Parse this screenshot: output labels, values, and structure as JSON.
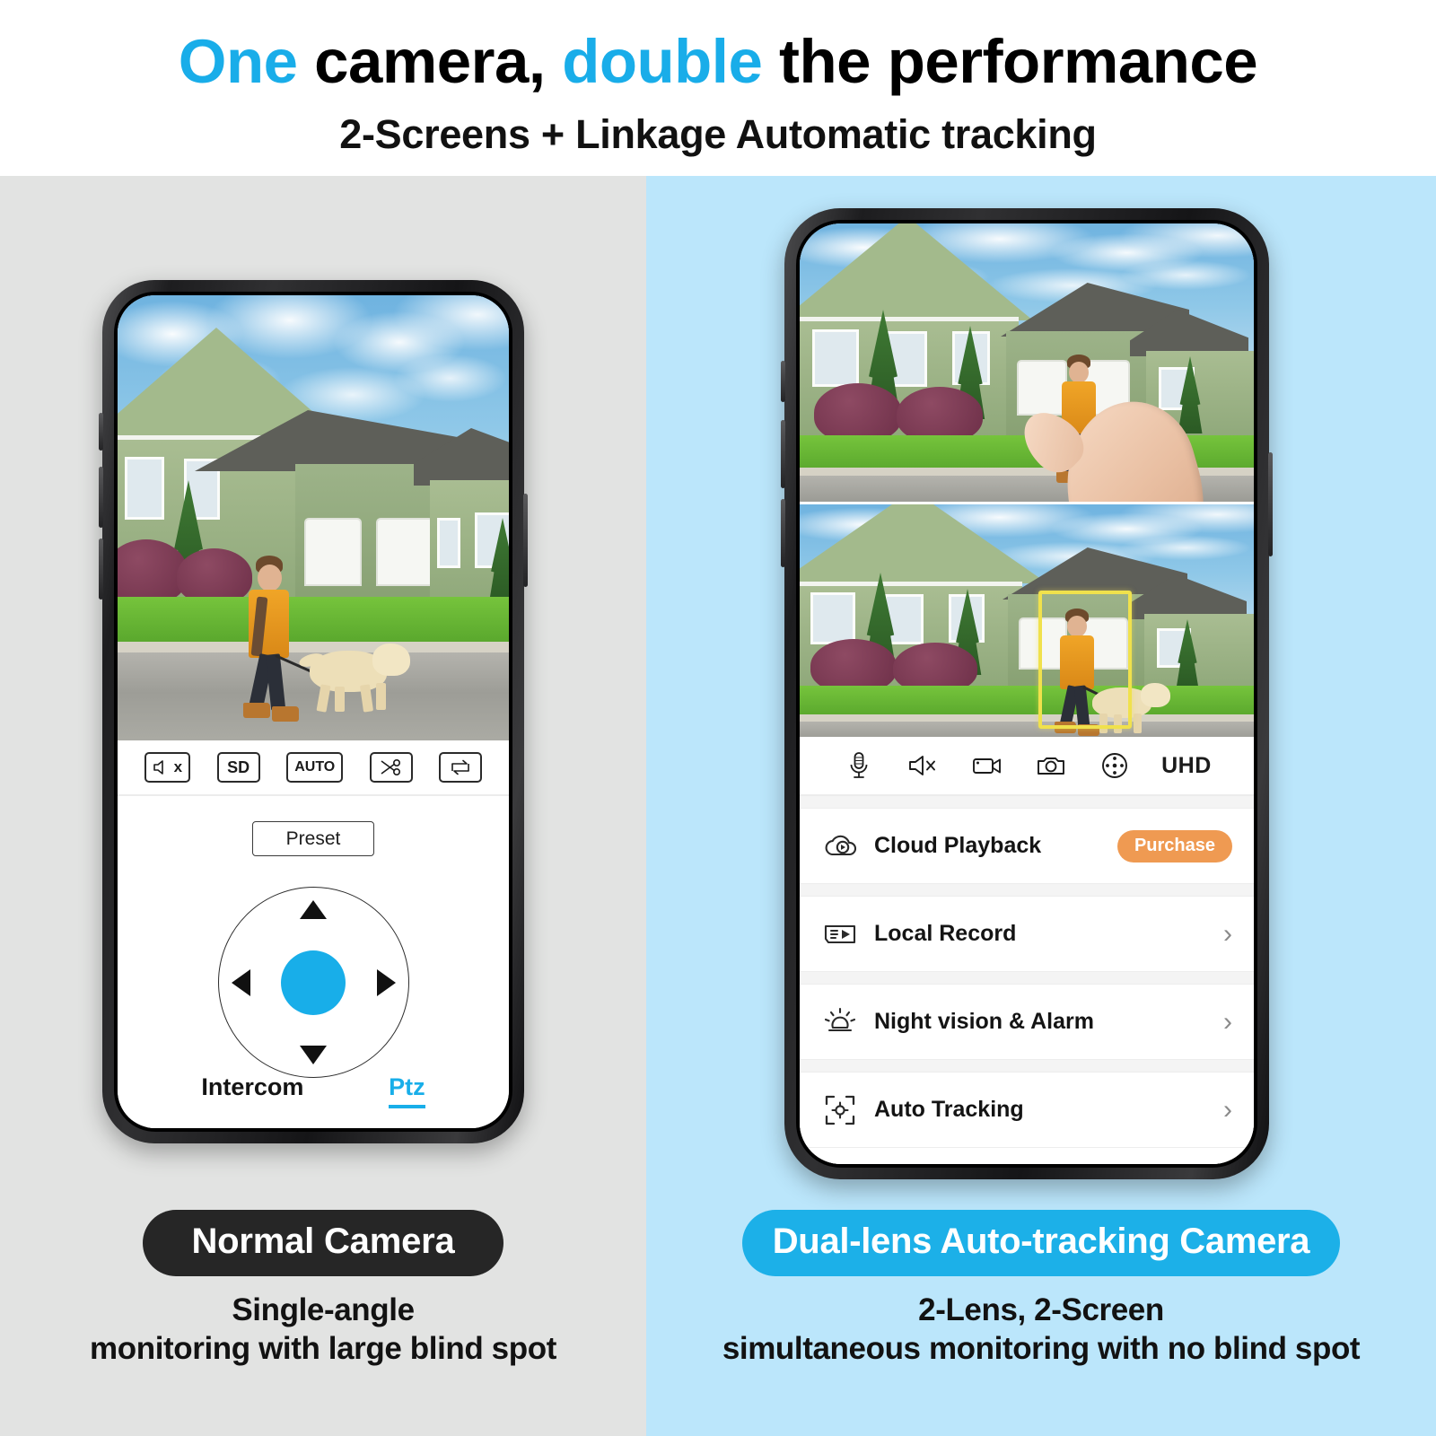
{
  "header": {
    "headline_part1": "One",
    "headline_part2": " camera, ",
    "headline_part3": "double",
    "headline_part4": " the performance",
    "subheadline": "2-Screens + Linkage Automatic tracking"
  },
  "colors": {
    "accent_blue": "#19ade9",
    "panel_left_bg": "#e2e3e2",
    "panel_right_bg": "#bbe6fb",
    "badge_dark": "#262626",
    "badge_blue": "#1cb0e8",
    "purchase_orange": "#ef9a52",
    "tracking_box_yellow": "#f0e14c"
  },
  "left_phone": {
    "toolbar": [
      {
        "name": "mute-speaker",
        "label": "x",
        "icon": "speaker-mute-icon"
      },
      {
        "name": "quality-sd",
        "label": "SD",
        "icon": "sd-quality-icon"
      },
      {
        "name": "quality-auto",
        "label": "AUTO",
        "icon": "auto-quality-icon"
      },
      {
        "name": "clip-cut",
        "label": "",
        "icon": "scissors-icon"
      },
      {
        "name": "loop-replay",
        "label": "",
        "icon": "loop-icon"
      }
    ],
    "preset_label": "Preset",
    "dpad": {
      "up": "up-arrow",
      "down": "down-arrow",
      "left": "left-arrow",
      "right": "right-arrow",
      "center": "ptz-center-button"
    },
    "tabs": [
      {
        "label": "Intercom",
        "active": false
      },
      {
        "label": "Ptz",
        "active": true
      }
    ]
  },
  "right_phone": {
    "toolbar": [
      {
        "name": "microphone",
        "icon": "microphone-icon",
        "label": ""
      },
      {
        "name": "mute-speaker",
        "icon": "speaker-mute-icon",
        "label": ""
      },
      {
        "name": "record-video",
        "icon": "video-camera-icon",
        "label": ""
      },
      {
        "name": "snapshot",
        "icon": "photo-camera-icon",
        "label": ""
      },
      {
        "name": "ptz-control",
        "icon": "ptz-dial-icon",
        "label": ""
      },
      {
        "name": "resolution",
        "icon": "",
        "label": "UHD"
      }
    ],
    "settings_rows": [
      {
        "label": "Cloud Playback",
        "icon": "cloud-playback-icon",
        "action": "Purchase",
        "action_type": "pill",
        "chevron": false
      },
      {
        "label": "Local Record",
        "icon": "local-record-icon",
        "action": "",
        "action_type": "chevron",
        "chevron": true
      },
      {
        "label": "Night vision & Alarm",
        "icon": "night-vision-alarm-icon",
        "action": "",
        "action_type": "chevron",
        "chevron": true
      },
      {
        "label": "Auto Tracking",
        "icon": "auto-tracking-icon",
        "action": "",
        "action_type": "chevron",
        "chevron": true
      }
    ]
  },
  "captions": {
    "left_badge": "Normal Camera",
    "left_line1": "Single-angle",
    "left_line2": "monitoring with large blind spot",
    "right_badge": "Dual-lens Auto-tracking Camera",
    "right_line1": "2-Lens, 2-Screen",
    "right_line2": "simultaneous monitoring with no blind spot"
  }
}
